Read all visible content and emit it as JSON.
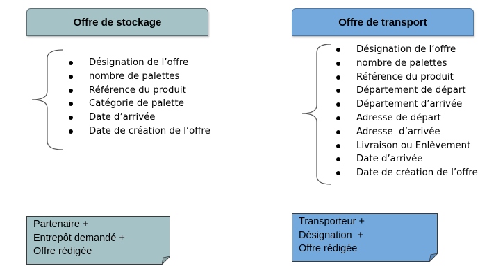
{
  "stockage": {
    "title": "Offre de stockage",
    "items": [
      "Désignation de l’offre",
      "nombre de palettes",
      "Référence du produit",
      "Catégorie de palette",
      "Date d’arrivée",
      "Date de création de l’offre"
    ],
    "note": [
      "Partenaire +",
      "Entrepôt demandé +",
      "Offre rédigée"
    ]
  },
  "transport": {
    "title": "Offre de transport",
    "items": [
      "Désignation de l’offre",
      "nombre de palettes",
      "Référence du produit",
      "Département de départ",
      "Département d’arrivée",
      "Adresse de départ",
      "Adresse  d’arrivée",
      "Livraison ou Enlèvement",
      "Date d’arrivée",
      "Date de création de l’offre"
    ],
    "note": [
      "Transporteur +",
      "Désignation  +",
      "Offre rédigée"
    ]
  },
  "colors": {
    "stockage": "#a5c3c6",
    "transport": "#74a9de"
  }
}
